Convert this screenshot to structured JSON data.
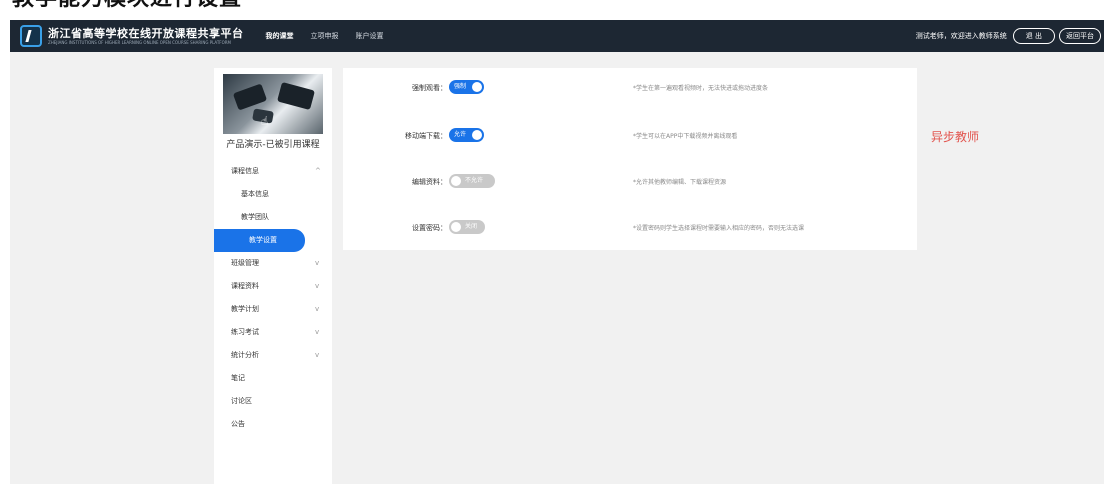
{
  "caption": "教学能力模块进行设置",
  "header": {
    "brand_cn": "浙江省高等学校在线开放课程共享平台",
    "brand_en": "ZHEJIANG INSTITUTIONS OF HIGHER LEARNING ONLINE OPEN COURSE SHARING PLATFORM",
    "nav": [
      "我的课堂",
      "立项申报",
      "账户设置"
    ],
    "welcome": "测试老师，欢迎进入教师系统",
    "logout": "退 出",
    "back": "返回平台"
  },
  "sidebar": {
    "course_title": "产品演示-已被引用课程",
    "menu": [
      {
        "label": "课程信息",
        "chevron": "^"
      },
      {
        "label": "基本信息"
      },
      {
        "label": "教学团队"
      },
      {
        "label": "教学设置"
      },
      {
        "label": "班级管理",
        "chevron": "v"
      },
      {
        "label": "课程资料",
        "chevron": "v"
      },
      {
        "label": "教学计划",
        "chevron": "v"
      },
      {
        "label": "练习考试",
        "chevron": "v"
      },
      {
        "label": "统计分析",
        "chevron": "v"
      },
      {
        "label": "笔记"
      },
      {
        "label": "讨论区"
      },
      {
        "label": "公告"
      }
    ]
  },
  "settings": [
    {
      "label": "强制观看：",
      "toggle": "强制",
      "on": true,
      "hint": "*学生在第一遍观看视频时，无法快进或拖动进度条"
    },
    {
      "label": "移动端下载：",
      "toggle": "允许",
      "on": true,
      "hint": "*学生可以在APP中下载视频并离线观看"
    },
    {
      "label": "编辑资料：",
      "toggle": "不允许",
      "on": false,
      "hint": "*允许其他教师编辑、下载课程资源"
    },
    {
      "label": "设置密码：",
      "toggle": "关闭",
      "on": false,
      "hint": "*设置密码则学生选择课程时需要输入相应的密码，否则无法选课"
    }
  ],
  "watermark": "异步教师",
  "colors": {
    "topbar": "#1d2733",
    "accent": "#1a73e8",
    "toggle_off": "#c9c9c9",
    "watermark": "#e2554f"
  }
}
